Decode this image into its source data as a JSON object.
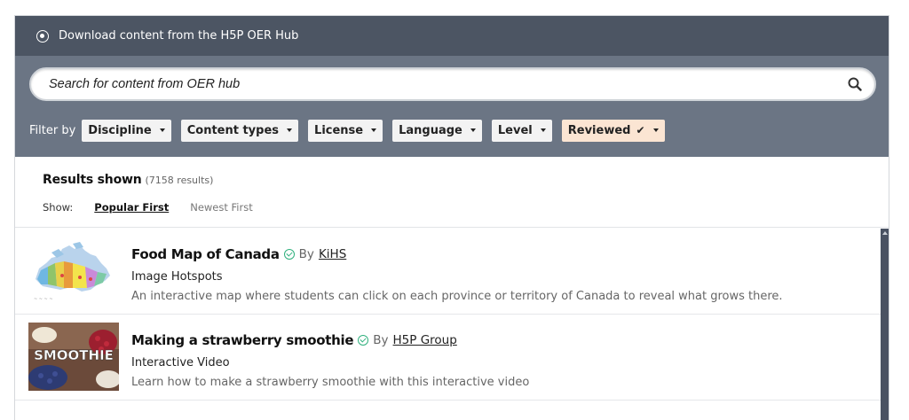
{
  "header": {
    "title": "Download content from the H5P OER Hub",
    "radio_icon": "radio-selected-icon"
  },
  "search": {
    "placeholder": "Search for content from OER hub",
    "icon": "search-icon"
  },
  "filters": {
    "label": "Filter by",
    "buttons": [
      {
        "label": "Discipline",
        "active": false
      },
      {
        "label": "Content types",
        "active": false
      },
      {
        "label": "License",
        "active": false
      },
      {
        "label": "Language",
        "active": false
      },
      {
        "label": "Level",
        "active": false
      },
      {
        "label": "Reviewed",
        "active": true,
        "checkmark": "✔"
      }
    ]
  },
  "results": {
    "title": "Results shown",
    "count": "(7158 results)",
    "show_label": "Show:",
    "sort_options": [
      {
        "label": "Popular First",
        "active": true
      },
      {
        "label": "Newest First",
        "active": false
      }
    ]
  },
  "items": [
    {
      "title": "Food Map of Canada",
      "by": "By",
      "author": "KiHS",
      "type": "Image Hotspots",
      "description": "An interactive map where students can click on each province or territory of Canada to reveal what grows there.",
      "thumbnail_icon": "canada-map-icon"
    },
    {
      "title": "Making a strawberry smoothie",
      "by": "By",
      "author": "H5P Group",
      "type": "Interactive Video",
      "description": "Learn how to make a strawberry smoothie with this interactive video",
      "thumbnail_icon": "smoothie-image-icon",
      "thumbnail_text": "SMOOTHIE"
    }
  ],
  "colors": {
    "header_bg": "#4c5563",
    "search_bg": "#6b7584",
    "active_filter_bg": "#fbe5d3",
    "verified_green": "#2fb07d"
  }
}
